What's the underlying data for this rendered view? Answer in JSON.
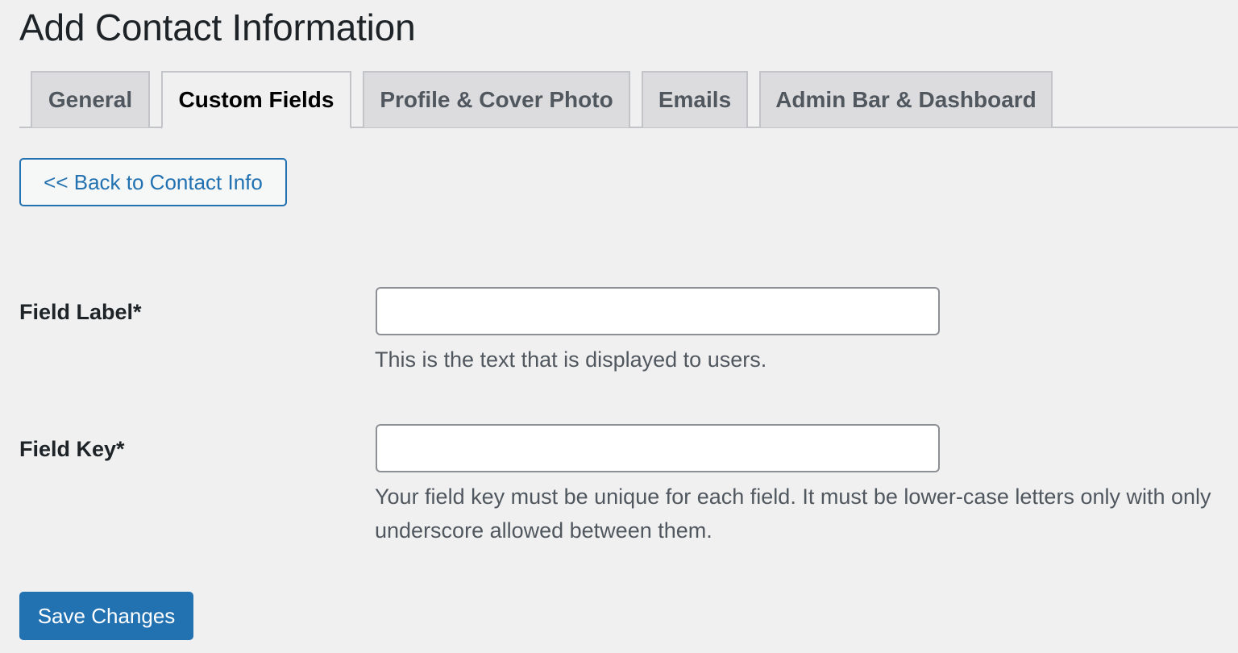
{
  "page": {
    "title": "Add Contact Information"
  },
  "tabs": [
    {
      "label": "General",
      "active": false
    },
    {
      "label": "Custom Fields",
      "active": true
    },
    {
      "label": "Profile & Cover Photo",
      "active": false
    },
    {
      "label": "Emails",
      "active": false
    },
    {
      "label": "Admin Bar & Dashboard",
      "active": false
    }
  ],
  "back_button": {
    "label": "<< Back to Contact Info"
  },
  "form": {
    "field_label": {
      "label": "Field Label*",
      "value": "",
      "description": "This is the text that is displayed to users."
    },
    "field_key": {
      "label": "Field Key*",
      "value": "",
      "description": "Your field key must be unique for each field. It must be lower-case letters only with only underscore allowed between them."
    }
  },
  "save_button": {
    "label": "Save Changes"
  },
  "colors": {
    "background": "#f0f0f1",
    "accent": "#2271b1",
    "tab_inactive_bg": "#dcdcde",
    "border": "#c3c4c7",
    "description_text": "#50575e"
  }
}
